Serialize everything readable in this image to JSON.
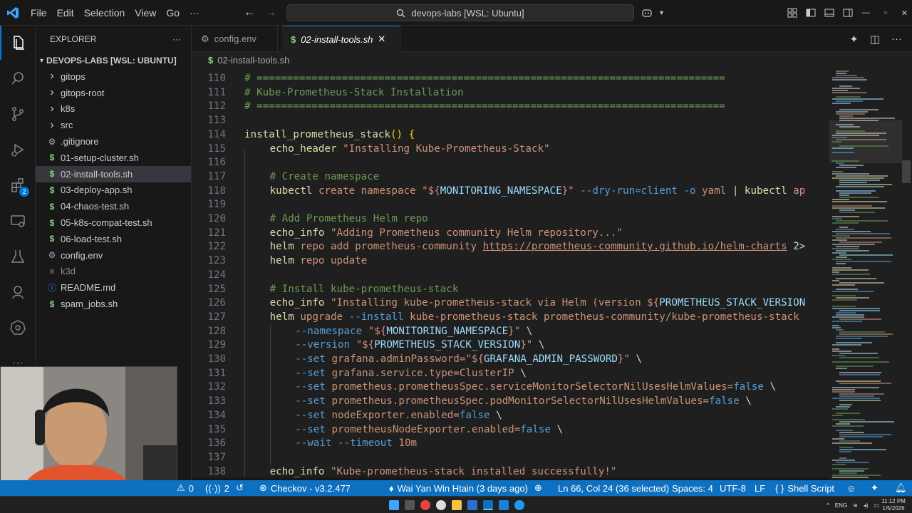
{
  "menu": [
    "File",
    "Edit",
    "Selection",
    "View",
    "Go",
    "···"
  ],
  "command_center": "devops-labs [WSL: Ubuntu]",
  "explorer": {
    "title": "EXPLORER",
    "more": "···",
    "root": "DEVOPS-LABS [WSL: UBUNTU]",
    "items": [
      {
        "label": "gitops",
        "kind": "folder"
      },
      {
        "label": "gitops-root",
        "kind": "folder"
      },
      {
        "label": "k8s",
        "kind": "folder"
      },
      {
        "label": "src",
        "kind": "folder"
      },
      {
        "label": ".gitignore",
        "kind": "gear"
      },
      {
        "label": "01-setup-cluster.sh",
        "kind": "shell"
      },
      {
        "label": "02-install-tools.sh",
        "kind": "shell"
      },
      {
        "label": "03-deploy-app.sh",
        "kind": "shell"
      },
      {
        "label": "04-chaos-test.sh",
        "kind": "shell"
      },
      {
        "label": "05-k8s-compat-test.sh",
        "kind": "shell"
      },
      {
        "label": "06-load-test.sh",
        "kind": "shell"
      },
      {
        "label": "config.env",
        "kind": "gear"
      },
      {
        "label": "k3d",
        "kind": "lines"
      },
      {
        "label": "README.md",
        "kind": "info"
      },
      {
        "label": "spam_jobs.sh",
        "kind": "shell"
      }
    ],
    "selected_index": 6
  },
  "tabs": [
    {
      "label": "config.env",
      "active": false
    },
    {
      "label": "02-install-tools.sh",
      "active": true
    }
  ],
  "tab_close": "✕",
  "breadcrumb": "02-install-tools.sh",
  "code_lines": [
    {
      "n": "110",
      "indent": 0,
      "tokens": [
        [
          "com",
          "# ============================================================================="
        ]
      ]
    },
    {
      "n": "111",
      "indent": 0,
      "tokens": [
        [
          "com",
          "# Kube-Prometheus-Stack Installation"
        ]
      ]
    },
    {
      "n": "112",
      "indent": 0,
      "tokens": [
        [
          "com",
          "# ============================================================================="
        ]
      ]
    },
    {
      "n": "113",
      "indent": 0,
      "tokens": []
    },
    {
      "n": "114",
      "indent": 0,
      "tokens": [
        [
          "fn",
          "install_prometheus_stack"
        ],
        [
          "brace",
          "() {"
        ]
      ]
    },
    {
      "n": "115",
      "indent": 1,
      "tokens": [
        [
          "fn",
          "echo_header"
        ],
        [
          "plain",
          " "
        ],
        [
          "str",
          "\"Installing Kube-Prometheus-Stack\""
        ]
      ]
    },
    {
      "n": "116",
      "indent": 1,
      "tokens": []
    },
    {
      "n": "117",
      "indent": 1,
      "tokens": [
        [
          "com",
          "# Create namespace"
        ]
      ]
    },
    {
      "n": "118",
      "indent": 1,
      "tokens": [
        [
          "fn",
          "kubectl"
        ],
        [
          "plain",
          " "
        ],
        [
          "str",
          "create namespace "
        ],
        [
          "str",
          "\"${"
        ],
        [
          "var",
          "MONITORING_NAMESPACE"
        ],
        [
          "str",
          "}\""
        ],
        [
          "plain",
          " "
        ],
        [
          "kw",
          "--dry-run=client"
        ],
        [
          "plain",
          " "
        ],
        [
          "kw",
          "-o"
        ],
        [
          "plain",
          " "
        ],
        [
          "str",
          "yaml"
        ],
        [
          "plain",
          " | "
        ],
        [
          "fn",
          "kubectl"
        ],
        [
          "plain",
          " "
        ],
        [
          "str",
          "ap"
        ]
      ]
    },
    {
      "n": "119",
      "indent": 1,
      "tokens": []
    },
    {
      "n": "120",
      "indent": 1,
      "tokens": [
        [
          "com",
          "# Add Prometheus Helm repo"
        ]
      ]
    },
    {
      "n": "121",
      "indent": 1,
      "tokens": [
        [
          "fn",
          "echo_info"
        ],
        [
          "plain",
          " "
        ],
        [
          "str",
          "\"Adding Prometheus community Helm repository...\""
        ]
      ]
    },
    {
      "n": "122",
      "indent": 1,
      "tokens": [
        [
          "fn",
          "helm"
        ],
        [
          "plain",
          " "
        ],
        [
          "str",
          "repo add prometheus-community "
        ],
        [
          "link",
          "https://prometheus-community.github.io/helm-charts"
        ],
        [
          "plain",
          " 2>"
        ]
      ]
    },
    {
      "n": "123",
      "indent": 1,
      "tokens": [
        [
          "fn",
          "helm"
        ],
        [
          "plain",
          " "
        ],
        [
          "str",
          "repo update"
        ]
      ]
    },
    {
      "n": "124",
      "indent": 1,
      "tokens": []
    },
    {
      "n": "125",
      "indent": 1,
      "tokens": [
        [
          "com",
          "# Install kube-prometheus-stack"
        ]
      ]
    },
    {
      "n": "126",
      "indent": 1,
      "tokens": [
        [
          "fn",
          "echo_info"
        ],
        [
          "plain",
          " "
        ],
        [
          "str",
          "\"Installing kube-prometheus-stack via Helm (version ${"
        ],
        [
          "var",
          "PROMETHEUS_STACK_VERSION"
        ]
      ]
    },
    {
      "n": "127",
      "indent": 1,
      "tokens": [
        [
          "fn",
          "helm"
        ],
        [
          "plain",
          " "
        ],
        [
          "str",
          "upgrade "
        ],
        [
          "kw",
          "--install"
        ],
        [
          "plain",
          " "
        ],
        [
          "str",
          "kube-prometheus-stack prometheus-community/kube-prometheus-stack"
        ]
      ]
    },
    {
      "n": "128",
      "indent": 2,
      "tokens": [
        [
          "kw",
          "--namespace"
        ],
        [
          "plain",
          " "
        ],
        [
          "str",
          "\"${"
        ],
        [
          "var",
          "MONITORING_NAMESPACE"
        ],
        [
          "str",
          "}\""
        ],
        [
          "plain",
          " \\"
        ]
      ]
    },
    {
      "n": "129",
      "indent": 2,
      "tokens": [
        [
          "kw",
          "--version"
        ],
        [
          "plain",
          " "
        ],
        [
          "str",
          "\"${"
        ],
        [
          "var",
          "PROMETHEUS_STACK_VERSION"
        ],
        [
          "str",
          "}\""
        ],
        [
          "plain",
          " \\"
        ]
      ]
    },
    {
      "n": "130",
      "indent": 2,
      "tokens": [
        [
          "kw",
          "--set"
        ],
        [
          "plain",
          " "
        ],
        [
          "str",
          "grafana.adminPassword=\"${"
        ],
        [
          "var",
          "GRAFANA_ADMIN_PASSWORD"
        ],
        [
          "str",
          "}\""
        ],
        [
          "plain",
          " \\"
        ]
      ]
    },
    {
      "n": "131",
      "indent": 2,
      "tokens": [
        [
          "kw",
          "--set"
        ],
        [
          "plain",
          " "
        ],
        [
          "str",
          "grafana.service.type=ClusterIP"
        ],
        [
          "plain",
          " \\"
        ]
      ]
    },
    {
      "n": "132",
      "indent": 2,
      "tokens": [
        [
          "kw",
          "--set"
        ],
        [
          "plain",
          " "
        ],
        [
          "str",
          "prometheus.prometheusSpec.serviceMonitorSelectorNilUsesHelmValues="
        ],
        [
          "kw",
          "false"
        ],
        [
          "plain",
          " \\"
        ]
      ]
    },
    {
      "n": "133",
      "indent": 2,
      "tokens": [
        [
          "kw",
          "--set"
        ],
        [
          "plain",
          " "
        ],
        [
          "str",
          "prometheus.prometheusSpec.podMonitorSelectorNilUsesHelmValues="
        ],
        [
          "kw",
          "false"
        ],
        [
          "plain",
          " \\"
        ]
      ]
    },
    {
      "n": "134",
      "indent": 2,
      "tokens": [
        [
          "kw",
          "--set"
        ],
        [
          "plain",
          " "
        ],
        [
          "str",
          "nodeExporter.enabled="
        ],
        [
          "kw",
          "false"
        ],
        [
          "plain",
          " \\"
        ]
      ]
    },
    {
      "n": "135",
      "indent": 2,
      "tokens": [
        [
          "kw",
          "--set"
        ],
        [
          "plain",
          " "
        ],
        [
          "str",
          "prometheusNodeExporter.enabled="
        ],
        [
          "kw",
          "false"
        ],
        [
          "plain",
          " \\"
        ]
      ]
    },
    {
      "n": "136",
      "indent": 2,
      "tokens": [
        [
          "kw",
          "--wait"
        ],
        [
          "plain",
          " "
        ],
        [
          "kw",
          "--timeout"
        ],
        [
          "plain",
          " "
        ],
        [
          "str",
          "10m"
        ]
      ]
    },
    {
      "n": "137",
      "indent": 2,
      "tokens": []
    },
    {
      "n": "138",
      "indent": 1,
      "tokens": [
        [
          "fn",
          "echo_info"
        ],
        [
          "plain",
          " "
        ],
        [
          "str",
          "\"Kube-prometheus-stack installed successfully!\""
        ]
      ]
    }
  ],
  "status": {
    "errors": "0",
    "warnings": "0",
    "ports": "2",
    "checkov": "Checkov - v3.2.477",
    "blame": "Wai Yan Win Htain (3 days ago)",
    "cursor": "Ln 66, Col 24 (36 selected)",
    "spaces": "Spaces: 4",
    "encoding": "UTF-8",
    "eol": "LF",
    "language": "Shell Script"
  },
  "taskbar": {
    "lang": "ENG",
    "time": "11:12 PM",
    "date": "1/5/2026"
  },
  "colors": {
    "accent": "#0078d4",
    "statusbar": "#0e70c0",
    "comment": "#6a9955",
    "function": "#dcdcaa",
    "string": "#ce9178",
    "variable": "#9cdcfe",
    "keyword": "#569cd6"
  }
}
